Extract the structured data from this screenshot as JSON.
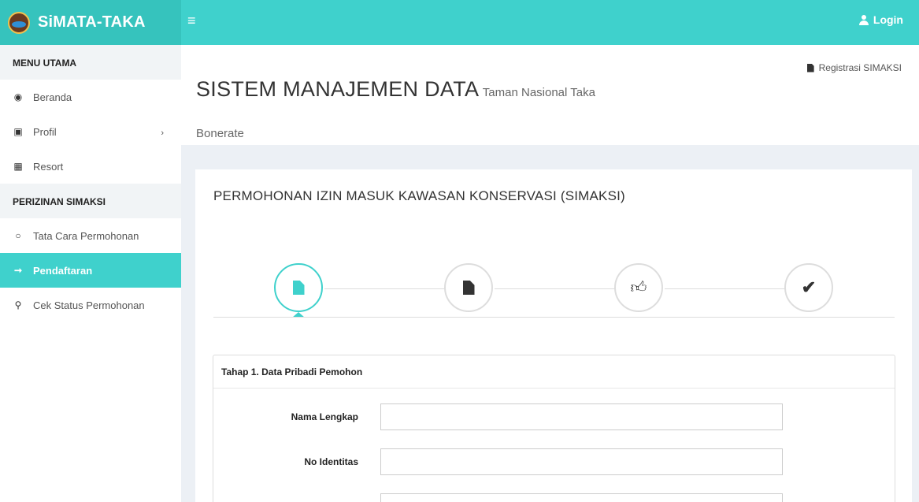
{
  "app": {
    "name": "SiMATA-TAKA",
    "login_label": "Login"
  },
  "sidebar": {
    "sections": [
      {
        "title": "MENU UTAMA"
      },
      {
        "title": "PERIZINAN SIMAKSI"
      }
    ],
    "items": [
      {
        "label": "Beranda",
        "icon": "dashboard-icon"
      },
      {
        "label": "Profil",
        "icon": "book-icon"
      },
      {
        "label": "Resort",
        "icon": "map-icon"
      },
      {
        "label": "Tata Cara Permohonan",
        "icon": "circle-icon"
      },
      {
        "label": "Pendaftaran",
        "icon": "sign-in-icon"
      },
      {
        "label": "Cek Status Permohonan",
        "icon": "search-icon"
      }
    ]
  },
  "header": {
    "title": "SISTEM MANAJEMEN DATA",
    "subtitle_part1": "Taman Nasional Taka",
    "subtitle_part2": "Bonerate",
    "register_link": "Registrasi SIMAKSI"
  },
  "main": {
    "box_title": "PERMOHONAN IZIN MASUK KAWASAN KONSERVASI (SIMAKSI)",
    "steps": [
      {
        "icon": "file-icon",
        "active": true
      },
      {
        "icon": "file-icon",
        "active": false
      },
      {
        "icon": "thumbs-up-icon",
        "active": false
      },
      {
        "icon": "check-icon",
        "active": false
      }
    ],
    "form": {
      "title": "Tahap 1. Data Pribadi Pemohon",
      "fields": [
        {
          "label": "Nama Lengkap",
          "value": ""
        },
        {
          "label": "No Identitas",
          "value": ""
        },
        {
          "label": "",
          "value": ""
        }
      ]
    }
  },
  "colors": {
    "accent": "#3fd1cc",
    "brand_bg": "#36c3bd",
    "page_bg": "#ecf0f5"
  }
}
